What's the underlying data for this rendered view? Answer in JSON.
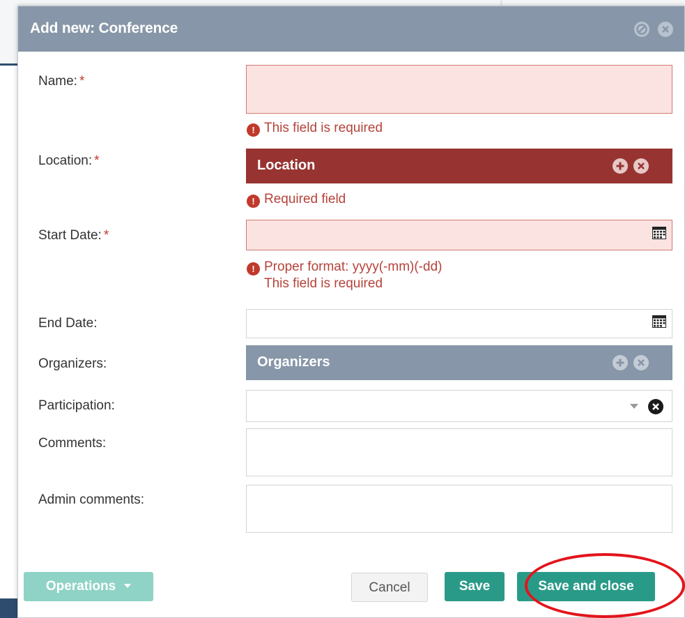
{
  "dialog": {
    "title": "Add new: Conference",
    "icons": [
      "minimize-icon",
      "close-icon"
    ]
  },
  "required_marker": "*",
  "fields": {
    "name": {
      "label": "Name:",
      "value": "",
      "error": "This field is required"
    },
    "location": {
      "label": "Location:",
      "picker_label": "Location",
      "error": "Required field"
    },
    "start_date": {
      "label": "Start Date:",
      "value": "",
      "error_line1": "Proper format: yyyy(-mm)(-dd)",
      "error_line2": "This field is required"
    },
    "end_date": {
      "label": "End Date:",
      "value": ""
    },
    "organizers": {
      "label": "Organizers:",
      "picker_label": "Organizers"
    },
    "participation": {
      "label": "Participation:",
      "value": ""
    },
    "comments": {
      "label": "Comments:",
      "value": ""
    },
    "admin_comments": {
      "label": "Admin comments:",
      "value": ""
    }
  },
  "footer": {
    "operations_label": "Operations",
    "cancel_label": "Cancel",
    "save_label": "Save",
    "save_close_label": "Save and close"
  },
  "colors": {
    "titlebar": "#8796a8",
    "error_field_bg": "#fbe3e1",
    "error_text": "#b5433a",
    "location_bar": "#973432",
    "organizers_bar": "#8796a8",
    "primary_button": "#2a9a88",
    "highlight_ring": "#e3141b"
  }
}
